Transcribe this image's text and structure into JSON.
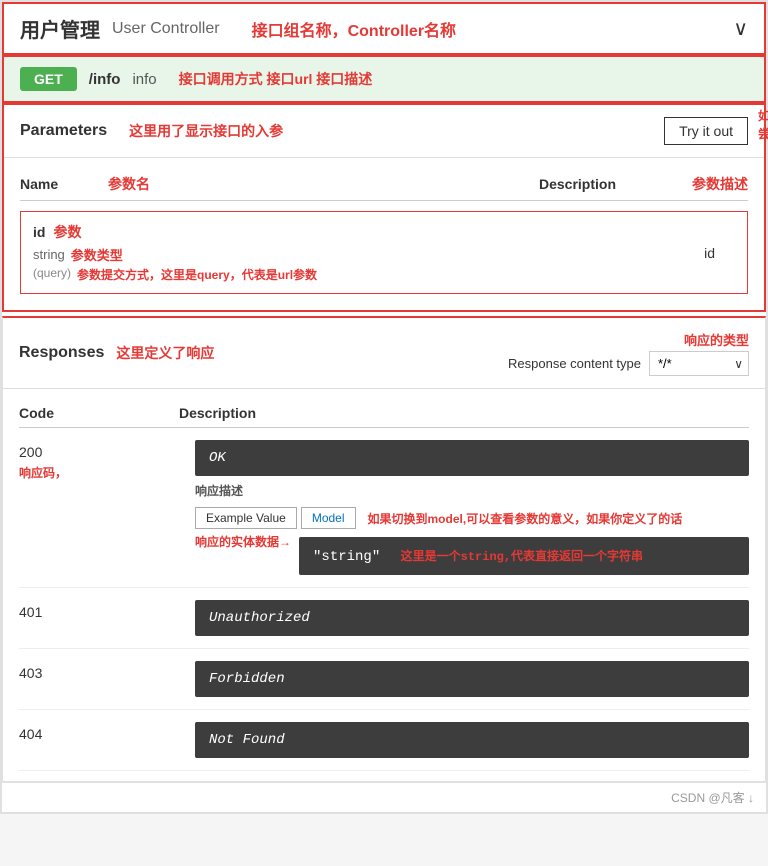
{
  "header": {
    "title_cn": "用户管理",
    "title_en": "User Controller",
    "annotation": "接口组名称，Controller名称",
    "chevron": "∨"
  },
  "endpoint": {
    "method": "GET",
    "path": "/info",
    "name": "info",
    "annotation": "接口调用方式 接口url 接口描述"
  },
  "parameters": {
    "label": "Parameters",
    "annotation": "这里用了显示接口的入参",
    "try_button": "Try it out",
    "try_annotation": "如果点击这里就可以在页面中尝试调用接口，后图再讲",
    "cols": {
      "name": "Name",
      "name_annotation": "参数名",
      "description": "Description",
      "description_annotation": "参数描述"
    },
    "params": [
      {
        "id": "id",
        "id_annotation": "参数",
        "type": "string",
        "type_annotation": "参数类型",
        "location": "(query)",
        "location_annotation": "参数提交方式，这里是query，代表是url参数",
        "description": "id"
      }
    ]
  },
  "responses": {
    "label": "Responses",
    "annotation": "这里定义了响应",
    "type_annotation": "响应的类型",
    "response_content_type_label": "Response content type",
    "response_content_type_value": "*/*",
    "cols": {
      "code": "Code",
      "description": "Description"
    },
    "items": [
      {
        "code": "200",
        "code_annotation": "响应码，",
        "description_text": "OK",
        "example_value_label": "Example Value",
        "model_label": "Model",
        "example_annotation": "如果切换到model,可以查看参数的意义，如果你定义了的话",
        "example_desc_annotation": "响应描述",
        "entity_annotation": "响应的实体数据→",
        "entity_value": "\"string\"",
        "entity_value_annotation": "这里是一个string,代表直接返回一个字符串"
      },
      {
        "code": "401",
        "description_text": "Unauthorized"
      },
      {
        "code": "403",
        "description_text": "Forbidden"
      },
      {
        "code": "404",
        "description_text": "Not Found"
      }
    ]
  },
  "footer": {
    "text": "CSDN @凡客 ↓"
  }
}
